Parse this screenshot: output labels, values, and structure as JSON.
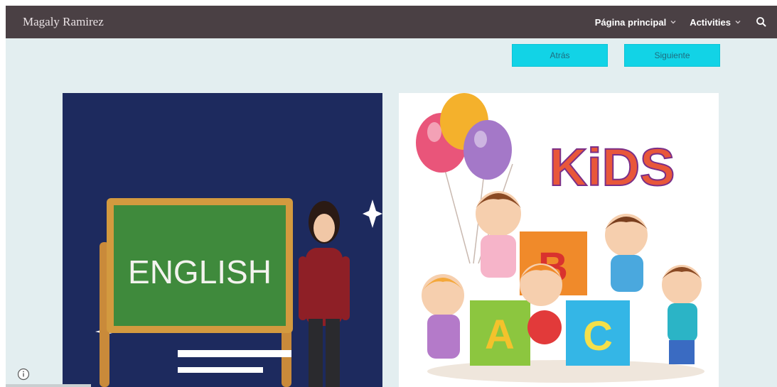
{
  "header": {
    "site_title": "Magaly Ramirez",
    "nav": [
      {
        "label": "Página principal",
        "icon": "chevron-down-icon"
      },
      {
        "label": "Activities",
        "icon": "chevron-down-icon"
      }
    ],
    "search_icon": "search-icon"
  },
  "pager": {
    "back_label": "Atrás",
    "next_label": "Siguiente"
  },
  "images": {
    "left": {
      "board_text": "ENGLISH"
    },
    "right": {
      "title_text": "KiDS",
      "block_letters": [
        "B",
        "A",
        "C"
      ]
    }
  },
  "colors": {
    "topbar": "#4a4044",
    "page_bg": "#e3eef0",
    "button_bg": "#12d3e6",
    "left_image_bg": "#1d2a5e"
  }
}
